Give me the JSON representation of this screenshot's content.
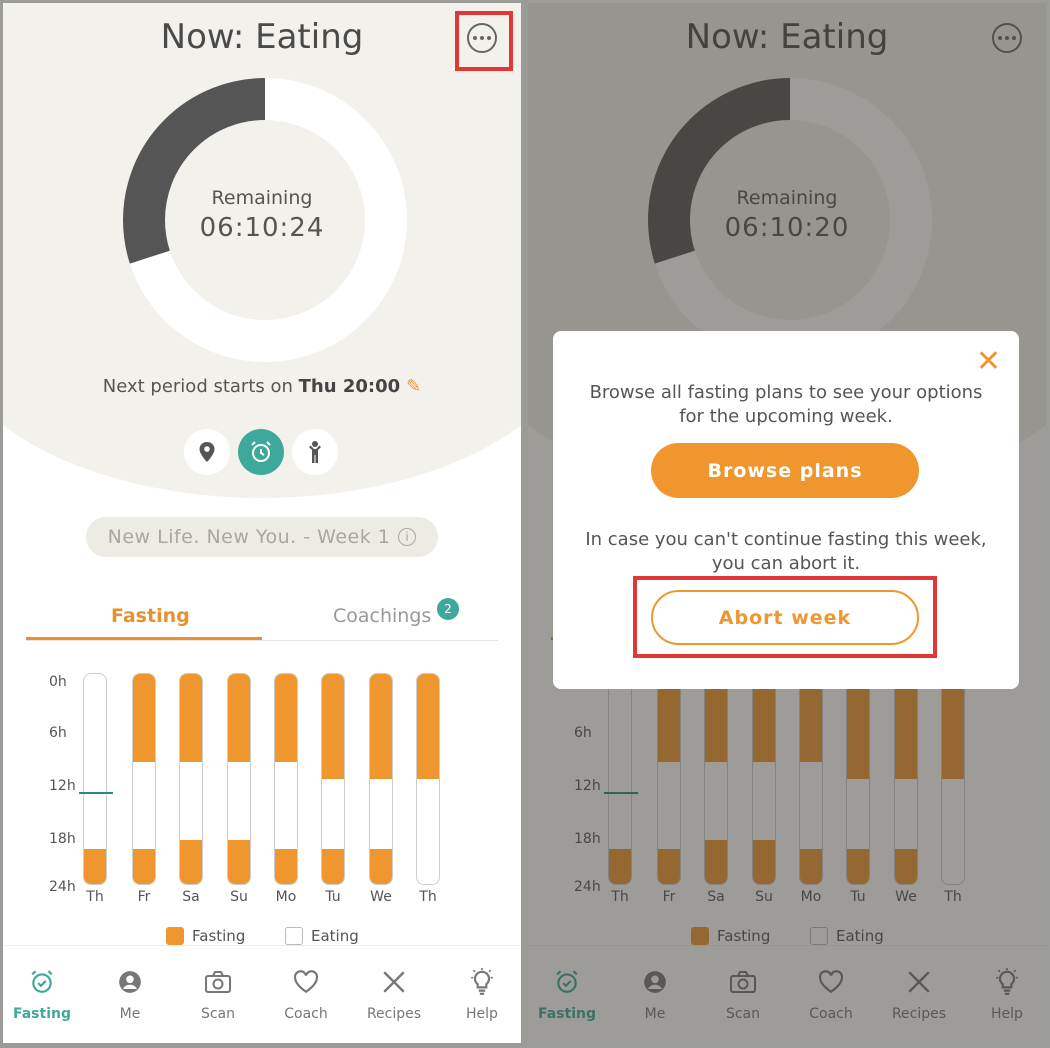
{
  "colors": {
    "accent": "#f0962f",
    "teal": "#3ea89a",
    "dark_ring": "#555555",
    "highlight": "#e03737"
  },
  "left": {
    "title": "Now: Eating",
    "remaining_label": "Remaining",
    "remaining_time": "06:10:24",
    "progress_fraction": 0.3,
    "next_prefix": "Next period starts on",
    "next_when": "Thu 20:00",
    "plan": "New Life. New You. - Week 1"
  },
  "right": {
    "title": "Now: Eating",
    "remaining_label": "Remaining",
    "remaining_time": "06:10:20",
    "progress_fraction": 0.3,
    "modal": {
      "browse_text": "Browse all fasting plans to see your options for the upcoming week.",
      "browse_button": "Browse plans",
      "abort_text": "In case you can't continue fasting this week, you can abort it.",
      "abort_button": "Abort week",
      "close_icon": "close-icon"
    }
  },
  "tabs": {
    "fasting": "Fasting",
    "coachings": "Coachings",
    "coachings_badge": "2"
  },
  "chart_data": {
    "type": "bar",
    "y_tick_labels": [
      "0h",
      "6h",
      "12h",
      "18h",
      "24h"
    ],
    "categories": [
      "Th",
      "Fr",
      "Sa",
      "Su",
      "Mo",
      "Tu",
      "We",
      "Th"
    ],
    "series": [
      {
        "name": "Fasting",
        "ranges_hours": [
          [
            [
              20,
              24
            ]
          ],
          [
            [
              0,
              10
            ],
            [
              20,
              24
            ]
          ],
          [
            [
              0,
              10
            ],
            [
              19,
              24
            ]
          ],
          [
            [
              0,
              10
            ],
            [
              19,
              24
            ]
          ],
          [
            [
              0,
              10
            ],
            [
              20,
              24
            ]
          ],
          [
            [
              0,
              12
            ],
            [
              20,
              24
            ]
          ],
          [
            [
              0,
              12
            ],
            [
              20,
              24
            ]
          ],
          [
            [
              0,
              12
            ]
          ]
        ]
      }
    ],
    "current_time_marker_hours": 13.5,
    "legend": [
      "Fasting",
      "Eating"
    ]
  },
  "nav": [
    {
      "label": "Fasting",
      "icon": "alarm-clock-icon"
    },
    {
      "label": "Me",
      "icon": "person-icon"
    },
    {
      "label": "Scan",
      "icon": "camera-icon"
    },
    {
      "label": "Coach",
      "icon": "heart-icon"
    },
    {
      "label": "Recipes",
      "icon": "cutlery-icon"
    },
    {
      "label": "Help",
      "icon": "lightbulb-icon"
    }
  ]
}
